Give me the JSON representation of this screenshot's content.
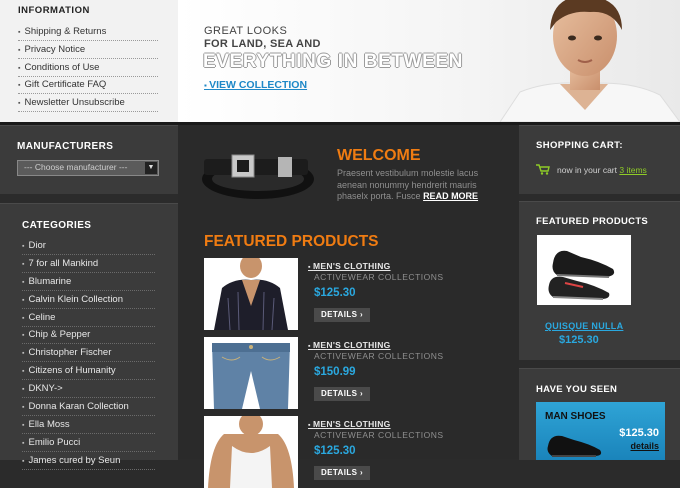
{
  "information": {
    "title": "INFORMATION",
    "links": [
      "Shipping & Returns",
      "Privacy Notice",
      "Conditions of Use",
      "Gift Certificate FAQ",
      "Newsletter Unsubscribe"
    ]
  },
  "hero": {
    "line1": "GREAT LOOKS",
    "line2": "FOR LAND, SEA AND",
    "line3": "EVERYTHING IN BETWEEN",
    "link": "VIEW COLLECTION"
  },
  "manufacturers": {
    "title": "MANUFACTURERS",
    "select_value": "--- Choose manufacturer ---"
  },
  "categories": {
    "title": "CATEGORIES",
    "items": [
      "Dior",
      "7 for all Mankind",
      "Blumarine",
      "Calvin Klein Collection",
      "Celine",
      "Chip & Pepper",
      "Christopher Fischer",
      "Citizens of Humanity",
      "DKNY->",
      "Donna Karan Collection",
      "Ella Moss",
      "Emilio Pucci",
      "James cured by Seun"
    ]
  },
  "welcome": {
    "title": "WELCOME",
    "text": "Praesent vestibulum molestie lacus aenean nonummy hendrerit mauris phaselx porta. Fusce",
    "read_more": "READ MORE"
  },
  "featured": {
    "title": "FEATURED PRODUCTS",
    "products": [
      {
        "category": "MEN'S CLOTHING",
        "sub": "ACTIVEWEAR COLLECTIONS",
        "price": "$125.30",
        "button": "DETAILS ›"
      },
      {
        "category": "MEN'S CLOTHING",
        "sub": "ACTIVEWEAR COLLECTIONS",
        "price": "$150.99",
        "button": "DETAILS ›"
      },
      {
        "category": "MEN'S CLOTHING",
        "sub": "ACTIVEWEAR COLLECTIONS",
        "price": "$125.30",
        "button": "DETAILS ›"
      }
    ]
  },
  "cart": {
    "title": "SHOPPING CART:",
    "text": "now in your cart",
    "items": "3 items"
  },
  "right_featured": {
    "title": "FEATURED PRODUCTS",
    "name": "QUISQUE NULLA",
    "price": "$125.30"
  },
  "have_you_seen": {
    "title": "HAVE YOU SEEN",
    "banner_title": "MAN SHOES",
    "banner_price": "$125.30",
    "banner_details": "details"
  },
  "icons": [
    "cart-icon",
    "dropdown-arrow-icon"
  ]
}
